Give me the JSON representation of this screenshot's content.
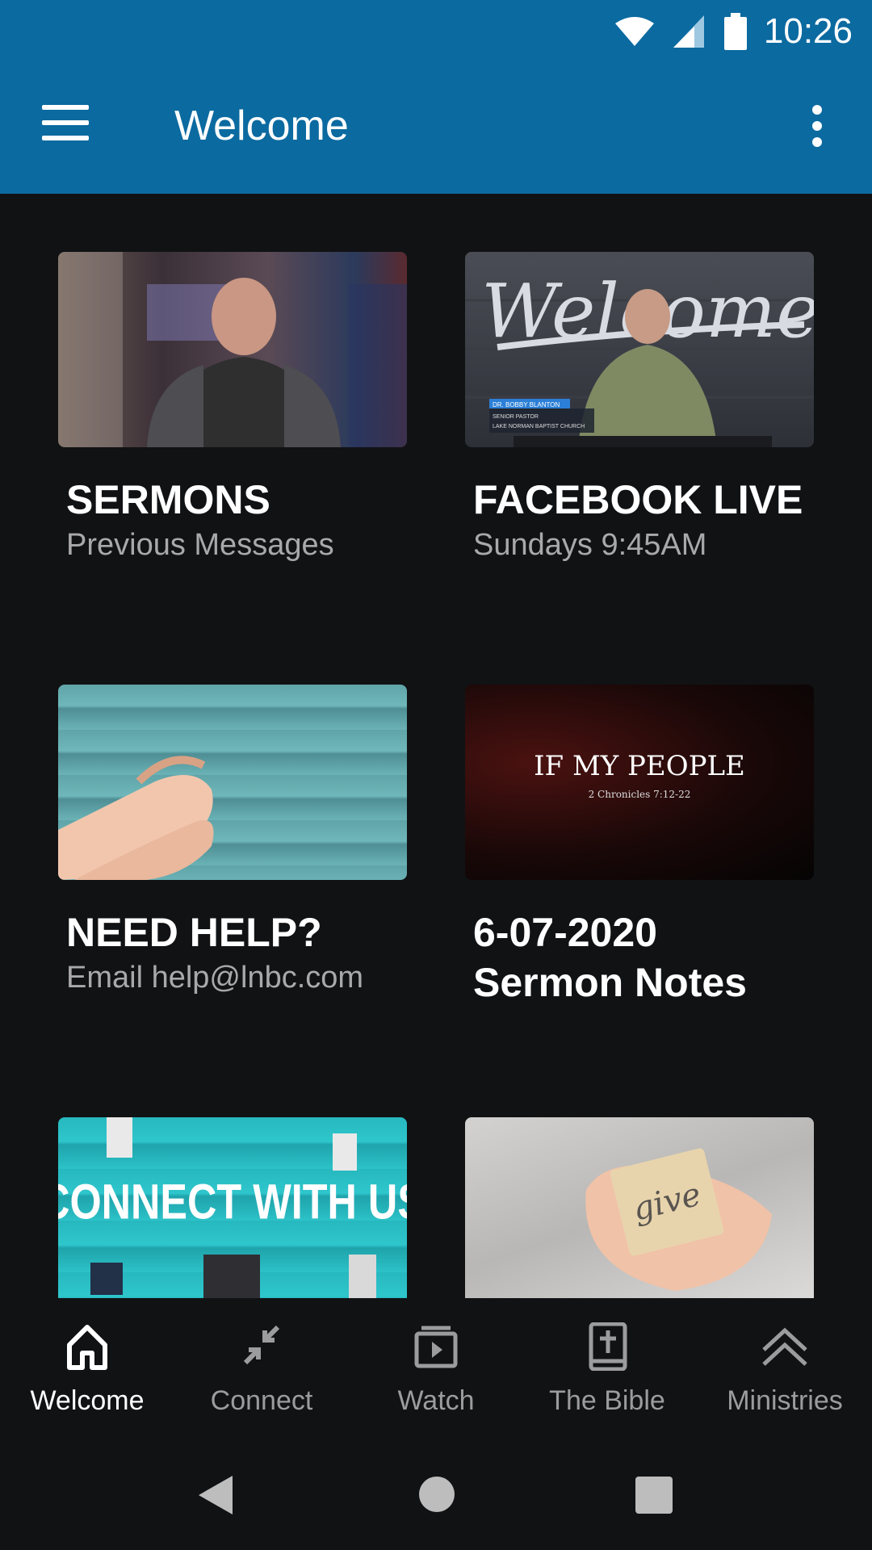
{
  "status": {
    "time": "10:26"
  },
  "appbar": {
    "title": "Welcome"
  },
  "cards": [
    {
      "title": "SERMONS",
      "subtitle": "Previous Messages"
    },
    {
      "title": "FACEBOOK LIVE",
      "subtitle": "Sundays 9:45AM",
      "overlay": {
        "big": "Welcome",
        "name": "DR. BOBBY BLANTON",
        "role": "SENIOR PASTOR",
        "church": "LAKE NORMAN BAPTIST CHURCH"
      }
    },
    {
      "title": "NEED HELP?",
      "subtitle": "Email help@lnbc.com"
    },
    {
      "title": "6-07-2020\nSermon Notes",
      "subtitle": "",
      "overlay": {
        "headline": "IF MY PEOPLE",
        "verse": "2 Chronicles 7:12-22"
      }
    },
    {
      "title": "",
      "subtitle": "",
      "overlay": {
        "text": "CONNECT WITH US"
      }
    },
    {
      "title": "",
      "subtitle": "",
      "overlay": {
        "text": "give"
      }
    }
  ],
  "bottom_nav": [
    {
      "label": "Welcome",
      "icon": "home-icon",
      "active": true
    },
    {
      "label": "Connect",
      "icon": "compress-arrows-icon",
      "active": false
    },
    {
      "label": "Watch",
      "icon": "video-library-icon",
      "active": false
    },
    {
      "label": "The Bible",
      "icon": "bible-icon",
      "active": false
    },
    {
      "label": "Ministries",
      "icon": "double-chevron-up-icon",
      "active": false
    }
  ],
  "colors": {
    "appbar": "#0b6aa0",
    "background": "#111214",
    "inactive": "#9c9c9f"
  }
}
